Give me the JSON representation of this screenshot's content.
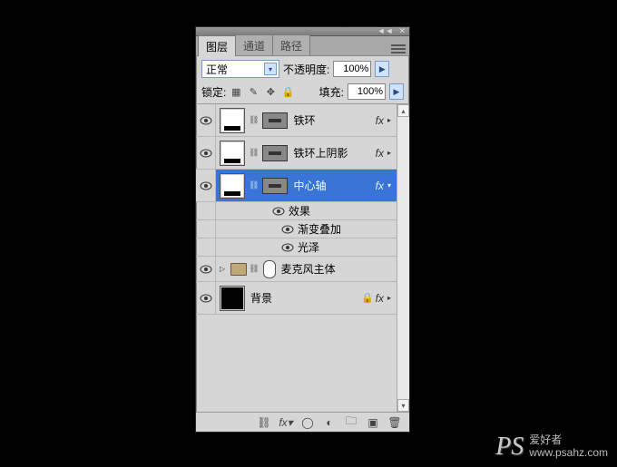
{
  "panel": {
    "tabs": [
      "图层",
      "通道",
      "路径"
    ],
    "active_tab": 0
  },
  "controls": {
    "blend_mode": "正常",
    "opacity_label": "不透明度:",
    "opacity_value": "100%",
    "lock_label": "锁定:",
    "fill_label": "填充:",
    "fill_value": "100%"
  },
  "layers": [
    {
      "name": "铁环",
      "has_fx": true,
      "selected": false,
      "mask": true,
      "expanded": false
    },
    {
      "name": "铁环上阴影",
      "has_fx": true,
      "selected": false,
      "mask": true,
      "expanded": false
    },
    {
      "name": "中心轴",
      "has_fx": true,
      "selected": true,
      "mask": true,
      "expanded": true,
      "effects_label": "效果",
      "effects": [
        "渐变叠加",
        "光泽"
      ]
    },
    {
      "name": "麦克风主体",
      "type": "group",
      "has_fx": false
    },
    {
      "name": "背景",
      "type": "bg",
      "locked": true,
      "has_fx": true
    }
  ],
  "fx_label": "fx",
  "watermark": {
    "logo": "PS",
    "cn": "爱好者",
    "url": "www.psahz.com"
  }
}
